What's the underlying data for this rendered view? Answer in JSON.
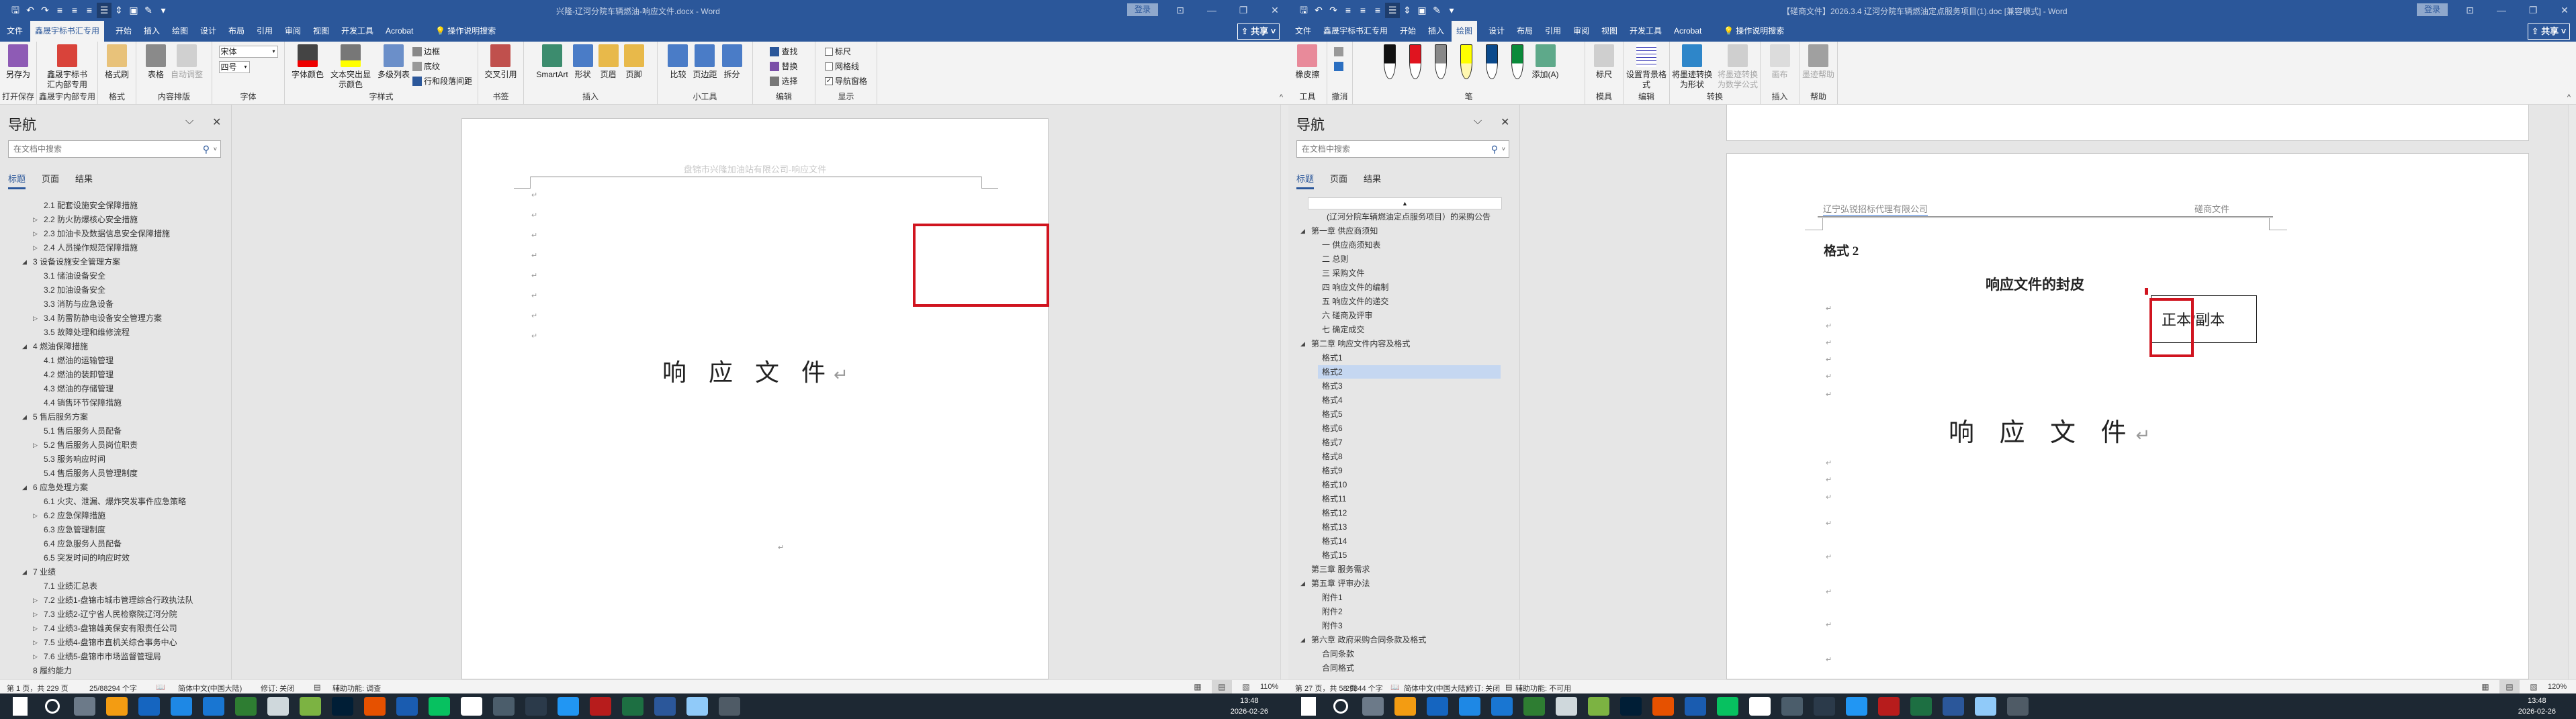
{
  "left": {
    "title": "兴隆-辽河分院车辆燃油-响应文件.docx  -  Word",
    "login": "登录",
    "share": "共享",
    "tabs": [
      "文件",
      "鑫晟宇标书汇专用",
      "开始",
      "插入",
      "绘图",
      "设计",
      "布局",
      "引用",
      "审阅",
      "视图",
      "开发工具",
      "Acrobat",
      "操作说明搜索"
    ],
    "active_tab": 1,
    "ribbon": [
      {
        "label": "打开保存",
        "items": [
          {
            "label": "另存为",
            "icon": "save-as"
          }
        ]
      },
      {
        "label": "鑫晟宇内部专用",
        "items": [
          {
            "label": "鑫晟宇标书汇内部专用",
            "icon": "house"
          }
        ]
      },
      {
        "label": "格式",
        "items": [
          {
            "label": "格式刷",
            "icon": "format-painter"
          }
        ]
      },
      {
        "label": "内容排版",
        "items": [
          {
            "label": "表格",
            "icon": "table"
          },
          {
            "label": "自动调整",
            "icon": "autofit",
            "disabled": true
          }
        ]
      },
      {
        "label": "字体",
        "items": [
          {
            "type": "select",
            "label": "宋体"
          },
          {
            "type": "select",
            "label": "四号"
          }
        ]
      },
      {
        "label": "字样式",
        "items": [
          {
            "label": "字体颜色",
            "icon": "font-color"
          },
          {
            "label": "文本突出显示颜色",
            "icon": "highlight"
          },
          {
            "label": "多级列表",
            "icon": "multilevel-list"
          },
          {
            "size": "small",
            "label": "边框",
            "icon": "border"
          },
          {
            "size": "small",
            "label": "底纹",
            "icon": "shading"
          },
          {
            "size": "small",
            "label": "行和段落间距",
            "icon": "line-spacing"
          }
        ]
      },
      {
        "label": "书签",
        "items": [
          {
            "label": "交叉引用",
            "icon": "cross-reference"
          }
        ]
      },
      {
        "label": "插入",
        "items": [
          {
            "label": "SmartArt",
            "icon": "smartart"
          },
          {
            "label": "形状",
            "icon": "shapes"
          },
          {
            "label": "页眉",
            "icon": "header"
          },
          {
            "label": "页脚",
            "icon": "footer"
          }
        ]
      },
      {
        "label": "小工具",
        "items": [
          {
            "label": "比较",
            "icon": "compare"
          },
          {
            "label": "页边距",
            "icon": "margins"
          },
          {
            "label": "拆分",
            "icon": "split"
          }
        ]
      },
      {
        "label": "编辑",
        "items": [
          {
            "size": "small",
            "label": "查找",
            "icon": "search"
          },
          {
            "size": "small",
            "label": "替换",
            "icon": "replace"
          },
          {
            "size": "small",
            "label": "选择",
            "icon": "select"
          }
        ]
      },
      {
        "label": "显示",
        "items": [
          {
            "size": "small",
            "type": "check",
            "label": "标尺",
            "checked": false
          },
          {
            "size": "small",
            "type": "check",
            "label": "网格线",
            "checked": false
          },
          {
            "size": "small",
            "type": "check",
            "label": "导航窗格",
            "checked": true
          }
        ]
      }
    ],
    "nav": {
      "title": "导航",
      "search_placeholder": "在文档中搜索",
      "tabs": [
        "标题",
        "页面",
        "结果"
      ],
      "items": [
        {
          "text": "2.1 配套设施安全保障措施",
          "level": 2,
          "arrow": "none"
        },
        {
          "text": "2.2 防火防爆核心安全措施",
          "level": 2,
          "arrow": "collapsed"
        },
        {
          "text": "2.3 加油卡及数据信息安全保障措施",
          "level": 2,
          "arrow": "collapsed"
        },
        {
          "text": "2.4 人员操作规范保障措施",
          "level": 2,
          "arrow": "collapsed"
        },
        {
          "text": "3 设备设施安全管理方案",
          "level": 1,
          "arrow": "expanded"
        },
        {
          "text": "3.1 储油设备安全",
          "level": 2,
          "arrow": "none"
        },
        {
          "text": "3.2 加油设备安全",
          "level": 2,
          "arrow": "none"
        },
        {
          "text": "3.3 消防与应急设备",
          "level": 2,
          "arrow": "none"
        },
        {
          "text": "3.4 防雷防静电设备安全管理方案",
          "level": 2,
          "arrow": "collapsed"
        },
        {
          "text": "3.5 故障处理和维修流程",
          "level": 2,
          "arrow": "none"
        },
        {
          "text": "4 燃油保障措施",
          "level": 1,
          "arrow": "expanded"
        },
        {
          "text": "4.1 燃油的运输管理",
          "level": 2,
          "arrow": "none"
        },
        {
          "text": "4.2 燃油的装卸管理",
          "level": 2,
          "arrow": "none"
        },
        {
          "text": "4.3 燃油的存储管理",
          "level": 2,
          "arrow": "none"
        },
        {
          "text": "4.4 销售环节保障措施",
          "level": 2,
          "arrow": "none"
        },
        {
          "text": "5 售后服务方案",
          "level": 1,
          "arrow": "expanded"
        },
        {
          "text": "5.1 售后服务人员配备",
          "level": 2,
          "arrow": "none"
        },
        {
          "text": "5.2 售后服务人员岗位职责",
          "level": 2,
          "arrow": "collapsed"
        },
        {
          "text": "5.3 服务响应时间",
          "level": 2,
          "arrow": "none"
        },
        {
          "text": "5.4 售后服务人员管理制度",
          "level": 2,
          "arrow": "none"
        },
        {
          "text": "6 应急处理方案",
          "level": 1,
          "arrow": "expanded"
        },
        {
          "text": "6.1 火灾、泄漏、爆炸突发事件应急策略",
          "level": 2,
          "arrow": "none"
        },
        {
          "text": "6.2 应急保障措施",
          "level": 2,
          "arrow": "collapsed"
        },
        {
          "text": "6.3 应急管理制度",
          "level": 2,
          "arrow": "none"
        },
        {
          "text": "6.4 应急服务人员配备",
          "level": 2,
          "arrow": "none"
        },
        {
          "text": "6.5 突发时间的响应时效",
          "level": 2,
          "arrow": "none"
        },
        {
          "text": "7 业绩",
          "level": 1,
          "arrow": "expanded"
        },
        {
          "text": "7.1 业绩汇总表",
          "level": 2,
          "arrow": "none"
        },
        {
          "text": "7.2 业绩1-盘锦市城市管理综合行政执法队",
          "level": 2,
          "arrow": "collapsed"
        },
        {
          "text": "7.3 业绩2-辽宁省人民检察院辽河分院",
          "level": 2,
          "arrow": "collapsed"
        },
        {
          "text": "7.4 业绩3-盘锦雄英保安有限责任公司",
          "level": 2,
          "arrow": "collapsed"
        },
        {
          "text": "7.5 业绩4-盘锦市直机关综合事务中心",
          "level": 2,
          "arrow": "collapsed"
        },
        {
          "text": "7.6 业绩5-盘锦市市场监督管理局",
          "level": 2,
          "arrow": "collapsed"
        },
        {
          "text": "8 履约能力",
          "level": 1,
          "arrow": "none"
        }
      ]
    },
    "doc": {
      "header": "盘锦市兴隆加油站有限公司-响应文件",
      "title": "响 应 文 件",
      "para_mark": "↵"
    },
    "status": {
      "page": "第 1 页，共 229 页",
      "words": "25/88294 个字",
      "language": "简体中文(中国大陆)",
      "track": "修订: 关闭",
      "accessibility": "辅助功能: 调查",
      "zoom": "110%"
    }
  },
  "right": {
    "title": "【磋商文件】2026.3.4 辽河分院车辆燃油定点服务项目(1).doc [兼容模式]  -  Word",
    "login": "登录",
    "share": "共享",
    "tabs": [
      "文件",
      "鑫晟宇标书汇专用",
      "开始",
      "插入",
      "绘图",
      "设计",
      "布局",
      "引用",
      "审阅",
      "视图",
      "开发工具",
      "Acrobat",
      "操作说明搜索"
    ],
    "active_tab": 4,
    "ribbon": [
      {
        "label": "工具",
        "items": [
          {
            "label": "橡皮擦",
            "icon": "eraser"
          }
        ]
      },
      {
        "label": "撤消",
        "items": [
          {
            "size": "small",
            "label": "",
            "icon": "undo"
          },
          {
            "size": "small",
            "label": "",
            "icon": "redo"
          }
        ]
      },
      {
        "label": "笔",
        "items": [
          {
            "label": "",
            "icon": "pen-black"
          },
          {
            "label": "",
            "icon": "pen-red"
          },
          {
            "label": "",
            "icon": "pencil-gray"
          },
          {
            "label": "",
            "icon": "highlighter-yellow"
          },
          {
            "label": "",
            "icon": "pen-blue"
          },
          {
            "label": "",
            "icon": "pen-green"
          },
          {
            "label": "添加(A)",
            "icon": "add"
          }
        ]
      },
      {
        "label": "模具",
        "items": [
          {
            "label": "标尺",
            "icon": "ruler"
          }
        ]
      },
      {
        "label": "编辑",
        "items": [
          {
            "label": "设置背景格式",
            "icon": "background-format"
          }
        ]
      },
      {
        "label": "转换",
        "items": [
          {
            "label": "将墨迹转换为形状",
            "icon": "ink-to-shape"
          },
          {
            "label": "将墨迹转换为数学公式",
            "icon": "ink-to-math",
            "disabled": true
          }
        ]
      },
      {
        "label": "插入",
        "items": [
          {
            "label": "画布",
            "icon": "canvas",
            "disabled": true
          }
        ]
      },
      {
        "label": "帮助",
        "items": [
          {
            "label": "墨迹帮助",
            "icon": "help",
            "disabled": true
          }
        ]
      }
    ],
    "nav": {
      "title": "导航",
      "search_placeholder": "在文档中搜索",
      "tabs": [
        "标题",
        "页面",
        "结果"
      ],
      "selected": 10,
      "items": [
        {
          "text": "(辽河分院车辆燃油定点服务项目）的采购公告",
          "level": 0,
          "arrow": "none"
        },
        {
          "text": "第一章 供应商须知",
          "level": 1,
          "arrow": "expanded"
        },
        {
          "text": "一 供应商须知表",
          "level": 2,
          "arrow": "none"
        },
        {
          "text": "二 总则",
          "level": 2,
          "arrow": "none"
        },
        {
          "text": "三 采购文件",
          "level": 2,
          "arrow": "none"
        },
        {
          "text": "四  响应文件的编制",
          "level": 2,
          "arrow": "none"
        },
        {
          "text": "五 响应文件的递交",
          "level": 2,
          "arrow": "none"
        },
        {
          "text": "六 磋商及评审",
          "level": 2,
          "arrow": "none"
        },
        {
          "text": "七 确定成交",
          "level": 2,
          "arrow": "none"
        },
        {
          "text": "第二章 响应文件内容及格式",
          "level": 1,
          "arrow": "expanded"
        },
        {
          "text": "格式1",
          "level": 2,
          "arrow": "none"
        },
        {
          "text": "格式2",
          "level": 2,
          "arrow": "none"
        },
        {
          "text": "格式3",
          "level": 2,
          "arrow": "none"
        },
        {
          "text": "格式4",
          "level": 2,
          "arrow": "none"
        },
        {
          "text": "格式5",
          "level": 2,
          "arrow": "none"
        },
        {
          "text": "格式6",
          "level": 2,
          "arrow": "none"
        },
        {
          "text": "格式7",
          "level": 2,
          "arrow": "none"
        },
        {
          "text": "格式8",
          "level": 2,
          "arrow": "none"
        },
        {
          "text": "格式9",
          "level": 2,
          "arrow": "none"
        },
        {
          "text": "格式10",
          "level": 2,
          "arrow": "none"
        },
        {
          "text": "格式11",
          "level": 2,
          "arrow": "none"
        },
        {
          "text": "格式12",
          "level": 2,
          "arrow": "none"
        },
        {
          "text": "格式13",
          "level": 2,
          "arrow": "none"
        },
        {
          "text": "格式14",
          "level": 2,
          "arrow": "none"
        },
        {
          "text": "格式15",
          "level": 2,
          "arrow": "none"
        },
        {
          "text": "第三章  服务需求",
          "level": 1,
          "arrow": "none"
        },
        {
          "text": "第五章 评审办法",
          "level": 1,
          "arrow": "expanded"
        },
        {
          "text": "附件1",
          "level": 2,
          "arrow": "none"
        },
        {
          "text": "附件2",
          "level": 2,
          "arrow": "none"
        },
        {
          "text": "附件3",
          "level": 2,
          "arrow": "none"
        },
        {
          "text": "第六章  政府采购合同条款及格式",
          "level": 1,
          "arrow": "expanded"
        },
        {
          "text": "合同条款",
          "level": 2,
          "arrow": "none"
        },
        {
          "text": "合同格式",
          "level": 2,
          "arrow": "none"
        }
      ]
    },
    "doc": {
      "header_left": "辽宁弘锐招标代理有限公司",
      "header_right": "磋商文件",
      "format_label": "格式 2",
      "subtitle": "响应文件的封皮",
      "copy_box": "正本/副本",
      "title": "响 应 文 件",
      "para_mark": "↵"
    },
    "status": {
      "page": "第 27 页，共 58 页",
      "words": "29844 个字",
      "language": "简体中文(中国大陆)",
      "track": "修订: 关闭",
      "accessibility": "辅助功能: 不可用",
      "zoom": "120%"
    }
  },
  "taskbar": {
    "left_icons": [
      "windows-start",
      "search",
      "calculator",
      "camera-app",
      "dots-app",
      "tencent-docs",
      "lark-app",
      "feather-app",
      "pen-tool-app",
      "green-circle-app",
      "photoshop",
      "orange-app",
      "dew-app",
      "wechat",
      "qq",
      "browser-q",
      "xmind",
      "quark",
      "acrobat",
      "excel",
      "word",
      "notes-app",
      "snake-app"
    ],
    "right_icons": [
      "windows-start",
      "search",
      "calculator",
      "camera-app",
      "dots-app",
      "tencent-docs",
      "lark-app",
      "feather-app",
      "pen-tool-app",
      "green-circle-app",
      "photoshop",
      "orange-app",
      "dew-app",
      "wechat",
      "qq",
      "browser-q",
      "xmind",
      "quark",
      "acrobat",
      "excel",
      "word",
      "notes-app",
      "snake-app"
    ],
    "time": "13:48",
    "date": "2026-02-26"
  },
  "colors": {
    "title_blue": "#2b579a",
    "red_box": "#d0141f",
    "highlight": "#c5d7f1"
  }
}
